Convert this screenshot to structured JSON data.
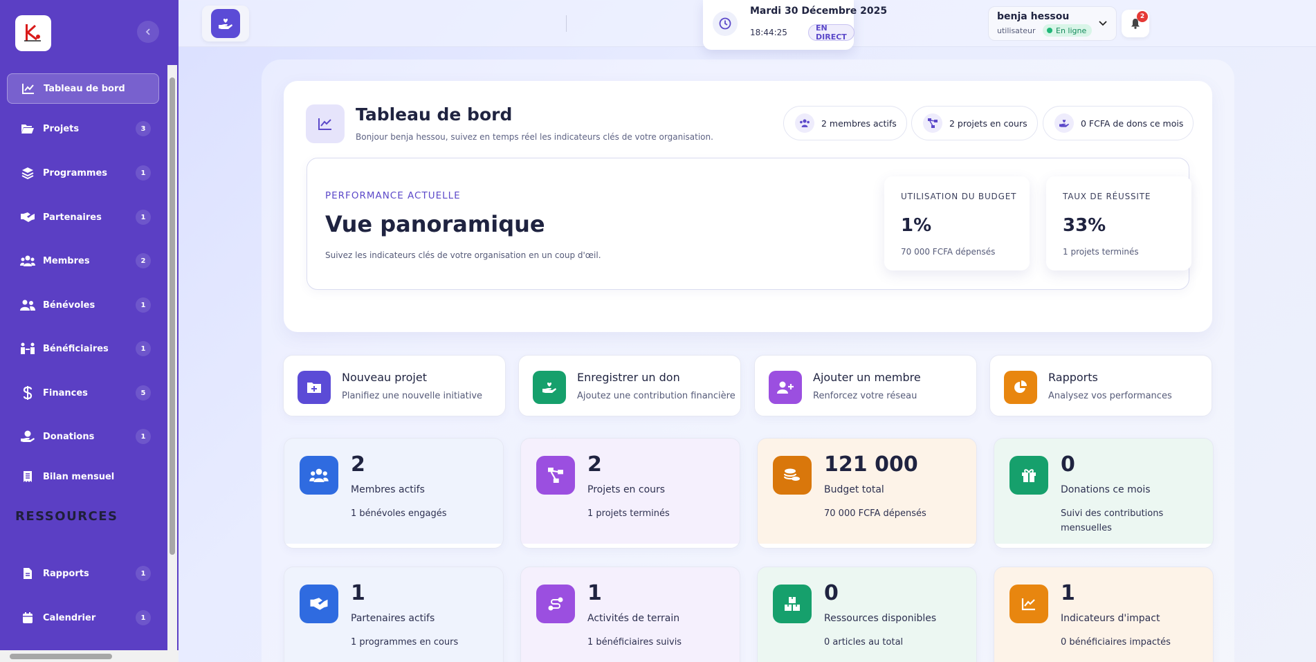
{
  "sidebar": {
    "items": [
      {
        "label": "Tableau de bord",
        "count": ""
      },
      {
        "label": "Projets",
        "count": "3"
      },
      {
        "label": "Programmes",
        "count": "1"
      },
      {
        "label": "Partenaires",
        "count": "1"
      },
      {
        "label": "Membres",
        "count": "2"
      },
      {
        "label": "Bénévoles",
        "count": "1"
      },
      {
        "label": "Bénéficiaires",
        "count": "1"
      },
      {
        "label": "Finances",
        "count": "5"
      },
      {
        "label": "Donations",
        "count": "1"
      },
      {
        "label": "Bilan mensuel",
        "count": ""
      }
    ],
    "section_title": "RESSOURCES",
    "resources": [
      {
        "label": "Rapports",
        "count": "1"
      },
      {
        "label": "Calendrier",
        "count": "1"
      }
    ]
  },
  "topbar": {
    "date": "Mardi 30 Décembre 2025",
    "time": "18:44:25",
    "live_label": "EN DIRECT",
    "notifications_count": "2",
    "user_name": "benja hessou",
    "user_role": "utilisateur",
    "user_status": "En ligne"
  },
  "hero": {
    "title": "Tableau de bord",
    "subtitle": "Bonjour benja hessou, suivez en temps réel les indicateurs clés de votre organisation.",
    "pills": [
      "2 membres actifs",
      "2 projets en cours",
      "0 FCFA de dons ce mois"
    ],
    "eyebrow": "PERFORMANCE ACTUELLE",
    "heading": "Vue panoramique",
    "description": "Suivez les indicateurs clés de votre organisation en un coup d'œil.",
    "metrics": [
      {
        "title": "UTILISATION DU BUDGET",
        "value": "1%",
        "sub": "70 000 FCFA dépensés"
      },
      {
        "title": "TAUX DE RÉUSSITE",
        "value": "33%",
        "sub": "1 projets terminés"
      }
    ]
  },
  "quick_actions": [
    {
      "title": "Nouveau projet",
      "subtitle": "Planifiez une nouvelle initiative",
      "icon": "folder-plus-icon",
      "color": "#5b4bd6"
    },
    {
      "title": "Enregistrer un don",
      "subtitle": "Ajoutez une contribution financière",
      "icon": "hand-heart-icon",
      "color": "#16a06c"
    },
    {
      "title": "Ajouter un membre",
      "subtitle": "Renforcez votre réseau",
      "icon": "user-plus-icon",
      "color": "#9b4fe0"
    },
    {
      "title": "Rapports",
      "subtitle": "Analysez vos performances",
      "icon": "pie-chart-icon",
      "color": "#e8860f"
    }
  ],
  "stats": [
    {
      "value": "2",
      "label": "Membres actifs",
      "sub": "1 bénévoles engagés",
      "icon": "users-icon",
      "color": "#2f6be0"
    },
    {
      "value": "2",
      "label": "Projets en cours",
      "sub": "1 projets terminés",
      "icon": "project-diagram-icon",
      "color": "#9b4fe0"
    },
    {
      "value": "121 000",
      "label": "Budget total",
      "sub": "70 000 FCFA dépensés",
      "icon": "coins-icon",
      "color": "#d9770b"
    },
    {
      "value": "0",
      "label": "Donations ce mois",
      "sub": "Suivi des contributions mensuelles",
      "icon": "gift-icon",
      "color": "#16a06c"
    },
    {
      "value": "1",
      "label": "Partenaires actifs",
      "sub": "1 programmes en cours",
      "icon": "handshake-icon",
      "color": "#2f6be0"
    },
    {
      "value": "1",
      "label": "Activités de terrain",
      "sub": "1 bénéficiaires suivis",
      "icon": "route-icon",
      "color": "#9b4fe0"
    },
    {
      "value": "0",
      "label": "Ressources disponibles",
      "sub": "0 articles au total",
      "icon": "boxes-icon",
      "color": "#16a06c"
    },
    {
      "value": "1",
      "label": "Indicateurs d'impact",
      "sub": "0 bénéficiaires impactés",
      "icon": "chart-line-icon",
      "color": "#e8860f"
    }
  ]
}
